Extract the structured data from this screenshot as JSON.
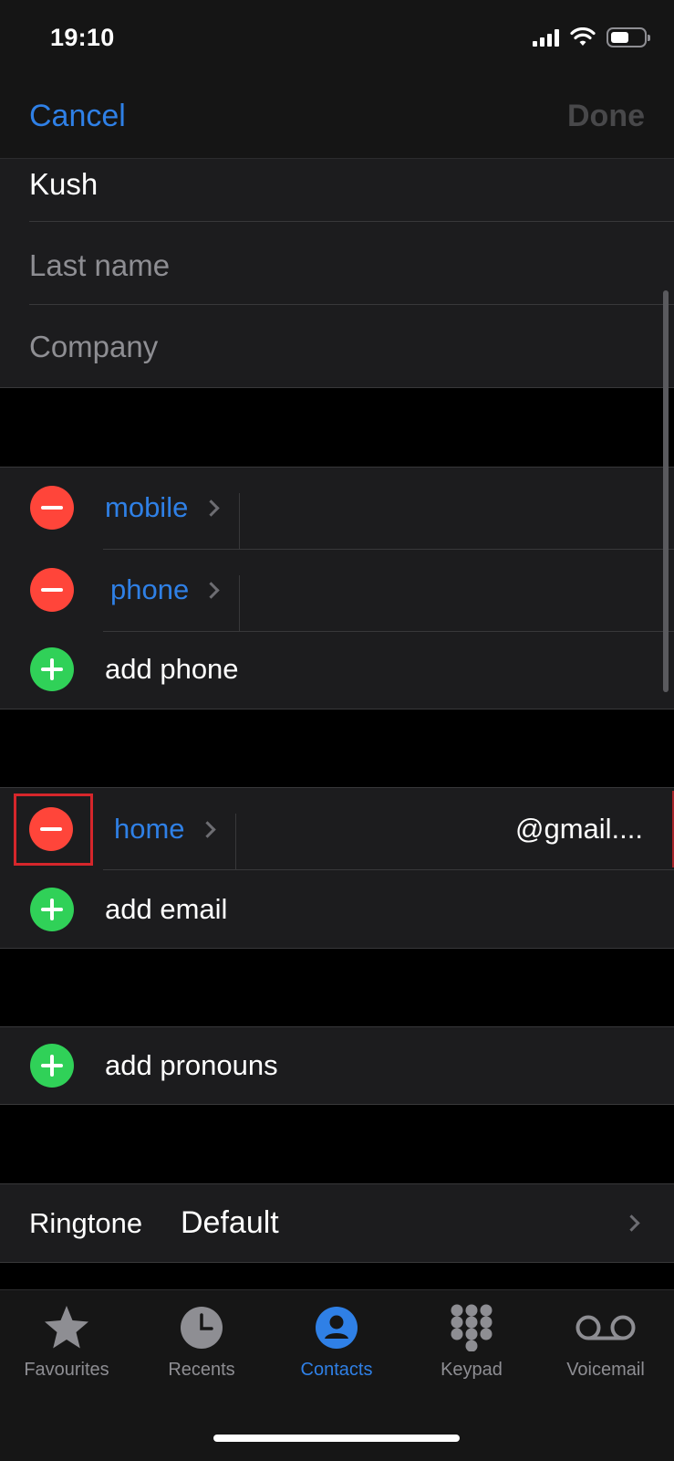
{
  "status_bar": {
    "time": "19:10"
  },
  "nav": {
    "cancel": "Cancel",
    "done": "Done"
  },
  "name_fields": {
    "first_name": "Kush",
    "last_name_placeholder": "Last name",
    "company_placeholder": "Company"
  },
  "phones": [
    {
      "label": "mobile"
    },
    {
      "label": "phone"
    }
  ],
  "add_phone": "add phone",
  "emails": [
    {
      "label": "home",
      "value": "@gmail...."
    }
  ],
  "add_email": "add email",
  "add_pronouns": "add pronouns",
  "ringtone": {
    "label": "Ringtone",
    "value": "Default"
  },
  "tabs": [
    {
      "label": "Favourites",
      "icon": "star-icon",
      "active": false
    },
    {
      "label": "Recents",
      "icon": "clock-icon",
      "active": false
    },
    {
      "label": "Contacts",
      "icon": "person-circle-icon",
      "active": true
    },
    {
      "label": "Keypad",
      "icon": "keypad-icon",
      "active": false
    },
    {
      "label": "Voicemail",
      "icon": "voicemail-icon",
      "active": false
    }
  ],
  "colors": {
    "accent": "#2f80e6",
    "delete": "#ff453a",
    "add": "#30d158",
    "highlight_box": "#d6262b"
  }
}
